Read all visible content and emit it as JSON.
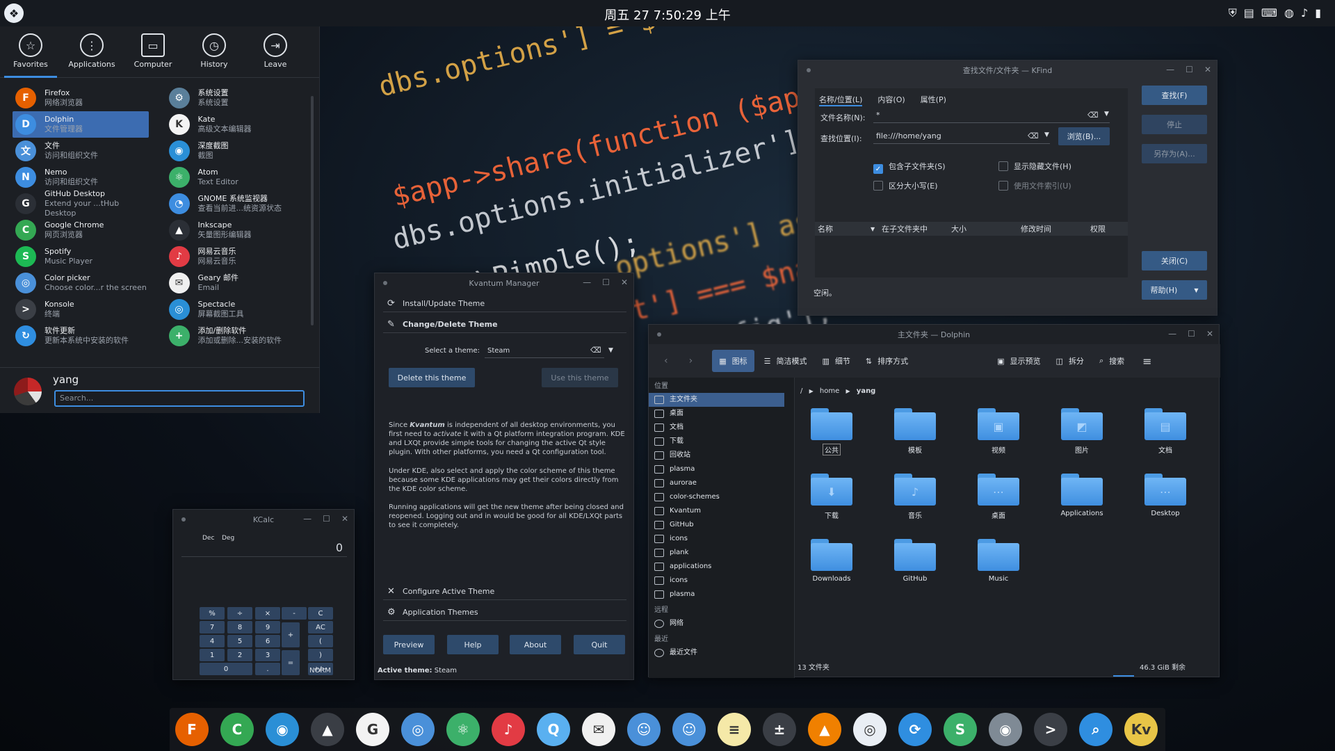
{
  "top_panel": {
    "clock": "周五 27  7:50:29 上午",
    "tray_icons": [
      "shield-icon",
      "clipboard-icon",
      "keyboard-icon",
      "network-icon",
      "volume-icon",
      "battery-icon"
    ]
  },
  "wallpaper": {
    "code_lines": [
      "dbs.options'] = $tmp;",
      "$app->share(function ($app) {",
      "dbs.options.initializer']();",
      "\\Pimple();",
      "options'] as $name =>",
      "'t'] === $name)",
      "config'];"
    ]
  },
  "kickoff": {
    "tabs": [
      {
        "label": "Favorites",
        "icon": "star-icon",
        "active": true
      },
      {
        "label": "Applications",
        "icon": "apps-icon",
        "active": false
      },
      {
        "label": "Computer",
        "icon": "computer-icon",
        "active": false
      },
      {
        "label": "History",
        "icon": "clock-icon",
        "active": false
      },
      {
        "label": "Leave",
        "icon": "leave-icon",
        "active": false
      }
    ],
    "left_apps": [
      {
        "name": "Firefox",
        "desc": "网络浏览器",
        "color": "#e66000",
        "glyph": "F"
      },
      {
        "name": "Dolphin",
        "desc": "文件管理器",
        "color": "#3d8de0",
        "glyph": "D"
      },
      {
        "name": "文件",
        "desc": "访问和组织文件",
        "color": "#4a90d9",
        "glyph": "文"
      },
      {
        "name": "Nemo",
        "desc": "访问和组织文件",
        "color": "#3d8de0",
        "glyph": "N"
      },
      {
        "name": "GitHub Desktop",
        "desc": "Extend your ...tHub Desktop",
        "color": "#2b2f36",
        "glyph": "G"
      },
      {
        "name": "Google Chrome",
        "desc": "网页浏览器",
        "color": "#34a853",
        "glyph": "C"
      },
      {
        "name": "Spotify",
        "desc": "Music Player",
        "color": "#1db954",
        "glyph": "S"
      },
      {
        "name": "Color picker",
        "desc": "Choose color...r the screen",
        "color": "#4a90d9",
        "glyph": "◎"
      },
      {
        "name": "Konsole",
        "desc": "终端",
        "color": "#3b3f46",
        "glyph": ">"
      },
      {
        "name": "软件更新",
        "desc": "更新本系统中安装的软件",
        "color": "#2f8ee0",
        "glyph": "↻"
      }
    ],
    "right_apps": [
      {
        "name": "系统设置",
        "desc": "系统设置",
        "color": "#5a7f9a",
        "glyph": "⚙"
      },
      {
        "name": "Kate",
        "desc": "高级文本编辑器",
        "color": "#f3f3f3",
        "glyph": "K"
      },
      {
        "name": "深度截图",
        "desc": "截图",
        "color": "#2a8fd6",
        "glyph": "◉"
      },
      {
        "name": "Atom",
        "desc": "Text Editor",
        "color": "#3cb06a",
        "glyph": "⚛"
      },
      {
        "name": "GNOME 系统监视器",
        "desc": "查看当前进...统资源状态",
        "color": "#3d8de0",
        "glyph": "◔"
      },
      {
        "name": "Inkscape",
        "desc": "矢量图形编辑器",
        "color": "#2b2f36",
        "glyph": "▲"
      },
      {
        "name": "网易云音乐",
        "desc": "网易云音乐",
        "color": "#e23b44",
        "glyph": "♪"
      },
      {
        "name": "Geary 邮件",
        "desc": "Email",
        "color": "#f0f0f0",
        "glyph": "✉"
      },
      {
        "name": "Spectacle",
        "desc": "屏幕截图工具",
        "color": "#2a8fd6",
        "glyph": "◎"
      },
      {
        "name": "添加/删除软件",
        "desc": "添加或删除...安装的软件",
        "color": "#3cb06a",
        "glyph": "+"
      }
    ],
    "user": "yang",
    "search_placeholder": "Search..."
  },
  "kfind": {
    "title": "查找文件/文件夹 — KFind",
    "tabs": [
      "名称/位置(L)",
      "内容(O)",
      "属性(P)"
    ],
    "name_label": "文件名称(N):",
    "name_value": "*",
    "location_label": "查找位置(I):",
    "location_value": "file:///home/yang",
    "browse": "浏览(B)...",
    "checks": [
      {
        "label": "包含子文件夹(S)",
        "on": true
      },
      {
        "label": "显示隐藏文件(H)",
        "on": false
      },
      {
        "label": "区分大小写(E)",
        "on": false
      },
      {
        "label": "使用文件索引(U)",
        "on": false
      }
    ],
    "columns": [
      "名称",
      "在子文件夹中",
      "大小",
      "修改时间",
      "权限"
    ],
    "status": "空闲。",
    "buttons": {
      "find": "查找(F)",
      "stop": "停止",
      "save_as": "另存为(A)...",
      "close": "关闭(C)",
      "help": "帮助(H)"
    }
  },
  "kvantum": {
    "title": "Kvantum Manager",
    "sections": {
      "install": "Install/Update Theme",
      "change": "Change/Delete Theme",
      "configure": "Configure Active Theme",
      "app_themes": "Application Themes"
    },
    "select_label": "Select a theme:",
    "select_value": "Steam",
    "delete_btn": "Delete this theme",
    "use_btn": "Use this theme",
    "para1_a": "Since ",
    "para1_b": "Kvantum",
    "para1_c": " is independent of all desktop environments, you first need to ",
    "para1_d": "activate",
    "para1_e": " it with a Qt platform integration program. KDE and LXQt provide simple tools for changing the active Qt style plugin. With other platforms, you need a Qt configuration tool.",
    "para2": "Under KDE, also select and apply the color scheme of this theme because some KDE applications may get their colors directly from the KDE color scheme.",
    "para3": "Running applications will get the new theme after being closed and reopened. Logging out and in would be good for all KDE/LXQt parts to see it completely.",
    "bottom_buttons": [
      "Preview",
      "Help",
      "About",
      "Quit"
    ],
    "active_label": "Active theme:",
    "active_value": "Steam"
  },
  "kcalc": {
    "title": "KCalc",
    "mode_dec": "Dec",
    "mode_deg": "Deg",
    "display": "0",
    "keys": [
      "%",
      "÷",
      "×",
      "-",
      "C",
      "7",
      "8",
      "9",
      "+",
      "AC",
      "4",
      "5",
      "6",
      "(",
      "1",
      "2",
      "3",
      "=",
      ")",
      "0",
      ".",
      "+/−"
    ],
    "status": "NORM"
  },
  "dolphin": {
    "title": "主文件夹 — Dolphin",
    "toolbar": {
      "icons": "图标",
      "compact": "简洁模式",
      "details": "细节",
      "sort": "排序方式",
      "preview": "显示预览",
      "split": "拆分",
      "search": "搜索"
    },
    "places_header": "位置",
    "places": [
      "主文件夹",
      "桌面",
      "文档",
      "下载",
      "回收站",
      "plasma",
      "aurorae",
      "color-schemes",
      "Kvantum",
      "GitHub",
      "icons",
      "plank",
      "applications",
      "icons",
      "plasma"
    ],
    "remote_header": "远程",
    "remote": [
      "网络"
    ],
    "recent_header": "最近",
    "recent": [
      "最近文件"
    ],
    "breadcrumb": [
      "/",
      "home",
      "yang"
    ],
    "folders": [
      "公共",
      "模板",
      "视频",
      "图片",
      "文档",
      "下载",
      "音乐",
      "桌面",
      "Applications",
      "Desktop",
      "Downloads",
      "GitHub",
      "Music"
    ],
    "status_count": "13 文件夹",
    "status_free": "46.3 GiB 剩余"
  },
  "dock": [
    {
      "name": "firefox",
      "color": "#e66000",
      "glyph": "F"
    },
    {
      "name": "chrome",
      "color": "#34a853",
      "glyph": "C"
    },
    {
      "name": "screenshot",
      "color": "#2a8fd6",
      "glyph": "◉"
    },
    {
      "name": "inkscape",
      "color": "#3a3e45",
      "glyph": "▲"
    },
    {
      "name": "github",
      "color": "#f3f3f3",
      "glyph": "G"
    },
    {
      "name": "chromium",
      "color": "#4a90d9",
      "glyph": "◎"
    },
    {
      "name": "atom",
      "color": "#3cb06a",
      "glyph": "⚛"
    },
    {
      "name": "netease-music",
      "color": "#e23b44",
      "glyph": "♪"
    },
    {
      "name": "qq",
      "color": "#5ab0f0",
      "glyph": "Q"
    },
    {
      "name": "mail",
      "color": "#f0f0f0",
      "glyph": "✉"
    },
    {
      "name": "finder",
      "color": "#4a90d9",
      "glyph": "☺"
    },
    {
      "name": "finder2",
      "color": "#4a90d9",
      "glyph": "☺"
    },
    {
      "name": "notes",
      "color": "#f5e9a8",
      "glyph": "≡"
    },
    {
      "name": "calculator",
      "color": "#3a3e45",
      "glyph": "±"
    },
    {
      "name": "vlc",
      "color": "#f08000",
      "glyph": "▲"
    },
    {
      "name": "safari",
      "color": "#e9eef4",
      "glyph": "◎"
    },
    {
      "name": "share",
      "color": "#2f8ee0",
      "glyph": "⟳"
    },
    {
      "name": "store",
      "color": "#3cb06a",
      "glyph": "S"
    },
    {
      "name": "camera",
      "color": "#7f8a95",
      "glyph": "◉"
    },
    {
      "name": "terminal",
      "color": "#3b3f46",
      "glyph": ">"
    },
    {
      "name": "search",
      "color": "#2f8ee0",
      "glyph": "⌕"
    },
    {
      "name": "kvantum",
      "color": "#e8c547",
      "glyph": "Kv"
    }
  ]
}
